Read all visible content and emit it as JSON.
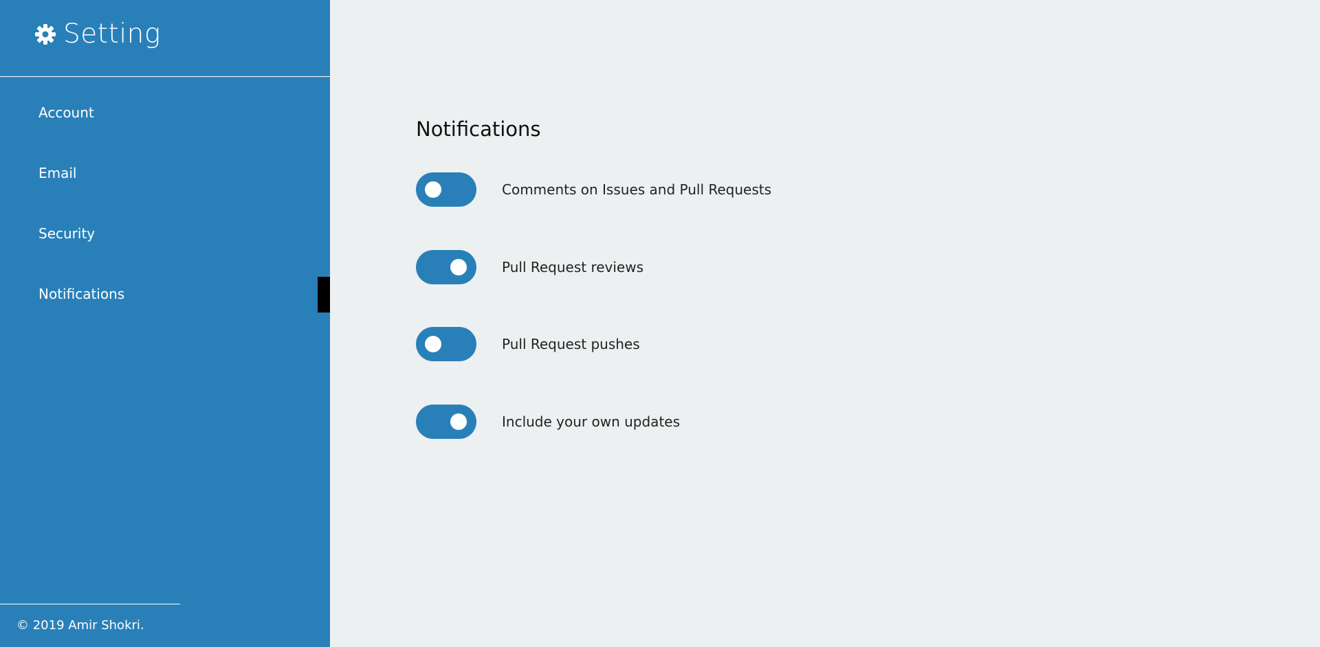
{
  "colors": {
    "sidebar_bg": "#2980b9",
    "main_bg": "#ecf0f1",
    "toggle_bg": "#2980b9",
    "active_indicator": "#000000"
  },
  "brand": {
    "icon": "gear-icon",
    "title": "Setting"
  },
  "sidebar": {
    "items": [
      {
        "label": "Account"
      },
      {
        "label": "Email"
      },
      {
        "label": "Security"
      },
      {
        "label": "Notifications",
        "active": true
      }
    ]
  },
  "footer": {
    "text": "© 2019 Amir Shokri."
  },
  "main": {
    "title": "Notifications",
    "settings": [
      {
        "label": "Comments on Issues and Pull Requests",
        "enabled": false
      },
      {
        "label": "Pull Request reviews",
        "enabled": true
      },
      {
        "label": "Pull Request pushes",
        "enabled": false
      },
      {
        "label": "Include your own updates",
        "enabled": true
      }
    ]
  }
}
